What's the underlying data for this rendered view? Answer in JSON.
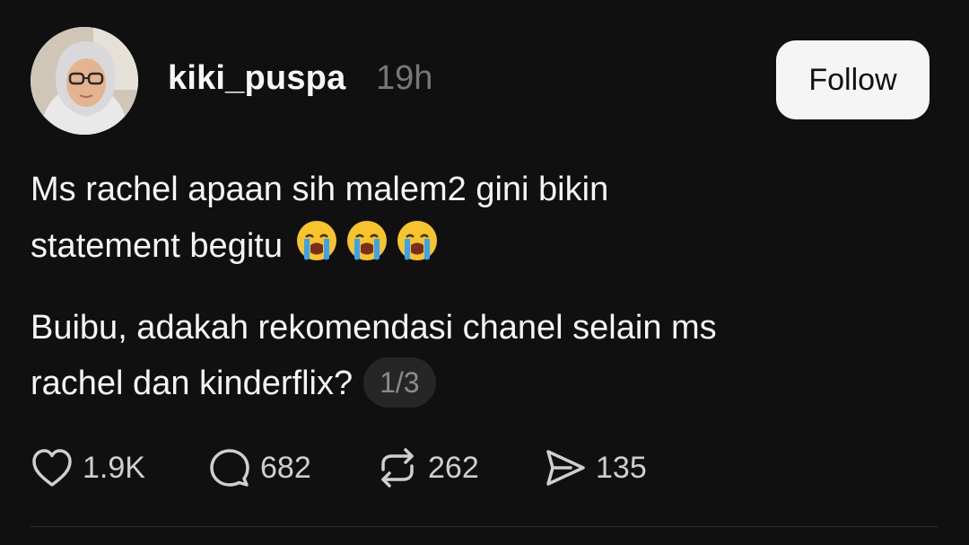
{
  "post": {
    "username": "kiki_puspa",
    "timestamp": "19h",
    "follow_label": "Follow",
    "paragraph1": {
      "line1": "Ms rachel apaan sih malem2 gini bikin",
      "line2": "statement begitu",
      "emoji": "😭😭😭"
    },
    "paragraph2": {
      "line1": "Buibu, adakah rekomendasi chanel selain ms",
      "line2": "rachel dan kinderflix?",
      "page_indicator": "1/3"
    },
    "stats": {
      "likes": "1.9K",
      "comments": "682",
      "reposts": "262",
      "shares": "135"
    }
  },
  "icons": {
    "like": "heart-icon",
    "comment": "speech-bubble-icon",
    "repost": "repost-icon",
    "share": "send-icon",
    "emoji": "loudly-crying-face-emoji"
  },
  "colors": {
    "background": "#101010",
    "text": "#f3f5f7",
    "muted": "#777777",
    "follow_bg": "#f5f5f5"
  }
}
